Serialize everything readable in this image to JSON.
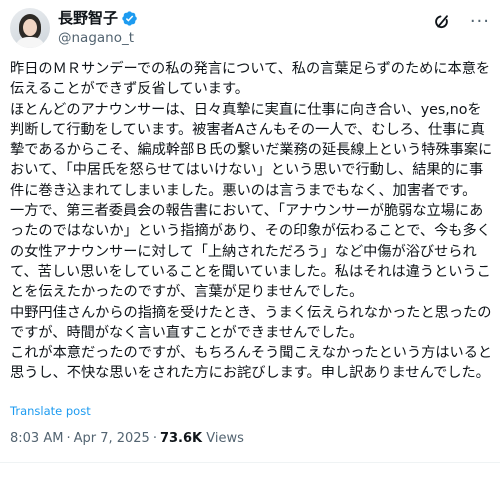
{
  "author": {
    "display_name": "長野智子",
    "handle": "@nagano_t",
    "verified": true
  },
  "post": {
    "text": "昨日のＭＲサンデーでの私の発言について、私の言葉足らずのために本意を伝えることができず反省しています。\nほとんどのアナウンサーは、日々真摯に実直に仕事に向き合い、yes,noを判断して行動をしています。被害者Aさんもその一人で、むしろ、仕事に真摯であるからこそ、編成幹部Ｂ氏の繋いだ業務の延長線上という特殊事案において、「中居氏を怒らせてはいけない」という思いで行動し、結果的に事件に巻き込まれてしまいました。悪いのは言うまでもなく、加害者です。\n一方で、第三者委員会の報告書において、「アナウンサーが脆弱な立場にあったのではないか」という指摘があり、その印象が伝わることで、今も多くの女性アナウンサーに対して「上納されただろう」など中傷が浴びせられて、苦しい思いをしていることを聞いていました。私はそれは違うということを伝えたかったのですが、言葉が足りませんでした。\n中野円佳さんからの指摘を受けたとき、うまく伝えられなかったと思ったのですが、時間がなく言い直すことができませんでした。\nこれが本意だったのですが、もちろんそう聞こえなかったという方はいると思うし、不快な思いをされた方にお詫びします。申し訳ありませんでした。",
    "translate_label": "Translate post",
    "time": "8:03 AM",
    "date": "Apr 7, 2025",
    "views_count": "73.6K",
    "views_label": "Views"
  },
  "icons": {
    "verified": "verified-badge-icon",
    "grok": "grok-icon",
    "more": "more-icon"
  },
  "colors": {
    "verified": "#1d9bf0",
    "link": "#1d9bf0",
    "secondary_text": "#536471",
    "primary_text": "#0f1419"
  }
}
